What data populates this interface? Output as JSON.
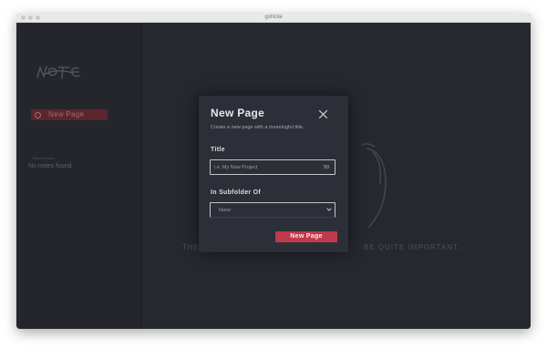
{
  "window": {
    "title": "goNote"
  },
  "sidebar": {
    "new_page_label": "New Page",
    "recent_label": "Recent notes",
    "empty_label": "No notes found"
  },
  "main": {
    "bg_text_left": "THE",
    "bg_text_right": "BE QUITE IMPORTANT..."
  },
  "modal": {
    "title": "New Page",
    "subtitle": "Create a new page with a meaningful title.",
    "title_field_label": "Title",
    "title_placeholder": "i.e. My New Project",
    "title_counter": "50",
    "subfolder_label": "In Subfolder Of",
    "subfolder_value": "None",
    "submit_label": "New Page"
  },
  "colors": {
    "accent": "#c03a4b",
    "background": "#2b2e36",
    "sidebar": "#292c33"
  }
}
